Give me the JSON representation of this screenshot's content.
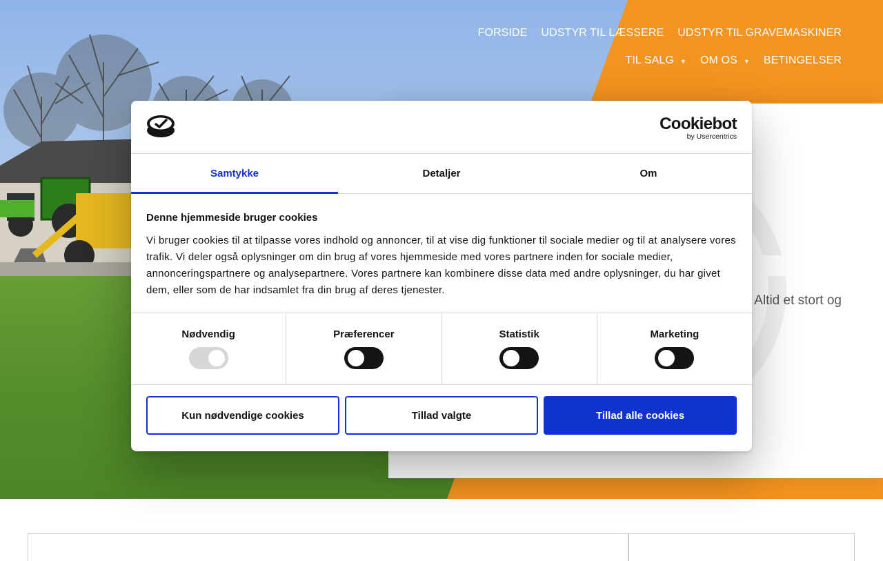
{
  "colors": {
    "accent_orange": "#f39320",
    "cookiebot_blue": "#1032cf",
    "dark_text": "#141414"
  },
  "nav": {
    "row1": [
      "FORSIDE",
      "UDSTYR TIL LÆSSERE",
      "UDSTYR TIL GRAVEMASKINER"
    ],
    "row2": [
      "TIL SALG",
      "OM OS",
      "BETINGELSER"
    ]
  },
  "hero": {
    "card_text": "Altid et stort og"
  },
  "cookie_dialog": {
    "brand_name": "Cookiebot",
    "brand_sub": "by Usercentrics",
    "tabs": [
      "Samtykke",
      "Detaljer",
      "Om"
    ],
    "active_tab": "Samtykke",
    "title": "Denne hjemmeside bruger cookies",
    "text": "Vi bruger cookies til at tilpasse vores indhold og annoncer, til at vise dig funktioner til sociale medier og til at analysere vores trafik. Vi deler også oplysninger om din brug af vores hjemmeside med vores partnere inden for sociale medier, annonceringspartnere og analysepartnere. Vores partnere kan kombinere disse data med andre oplysninger, du har givet dem, eller som de har indsamlet fra din brug af deres tjenester.",
    "categories": [
      {
        "label": "Nødvendig",
        "enabled": true,
        "locked": true
      },
      {
        "label": "Præferencer",
        "enabled": false
      },
      {
        "label": "Statistik",
        "enabled": false
      },
      {
        "label": "Marketing",
        "enabled": false
      }
    ],
    "buttons": {
      "necessary_only": "Kun nødvendige cookies",
      "allow_selected": "Tillad valgte",
      "allow_all": "Tillad alle cookies"
    }
  }
}
